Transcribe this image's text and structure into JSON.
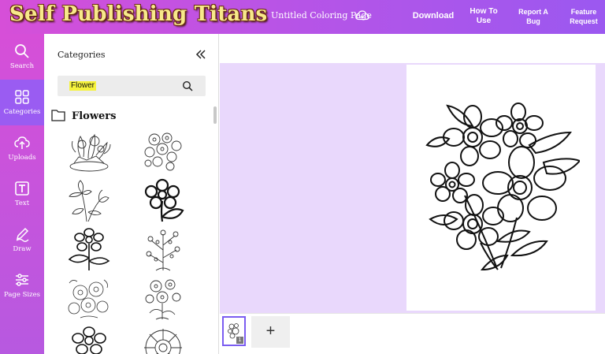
{
  "header": {
    "logo": "Self Publishing Titans",
    "document_title": "Untitled Coloring Page",
    "download": "Download",
    "how_to_use": "How To Use",
    "report_bug": "Report A Bug",
    "feature_request": "Feature Request"
  },
  "rail": {
    "items": [
      {
        "label": "Search",
        "icon": "search-icon"
      },
      {
        "label": "Categories",
        "icon": "grid-icon",
        "active": true
      },
      {
        "label": "Uploads",
        "icon": "upload-cloud-icon"
      },
      {
        "label": "Text",
        "icon": "text-icon"
      },
      {
        "label": "Draw",
        "icon": "pen-icon"
      },
      {
        "label": "Page Sizes",
        "icon": "sliders-icon"
      }
    ]
  },
  "panel": {
    "title": "Categories",
    "search": {
      "value": "Flower"
    },
    "category_heading": "Flowers"
  },
  "canvas": {
    "current_page": "1",
    "add_page_label": "+"
  },
  "colors": {
    "header_start": "#d64fd8",
    "header_end": "#9b58f0",
    "rail_active": "#9a5cf2",
    "canvas_bg": "#e9d8fc",
    "search_highlight": "#f6f33c"
  }
}
